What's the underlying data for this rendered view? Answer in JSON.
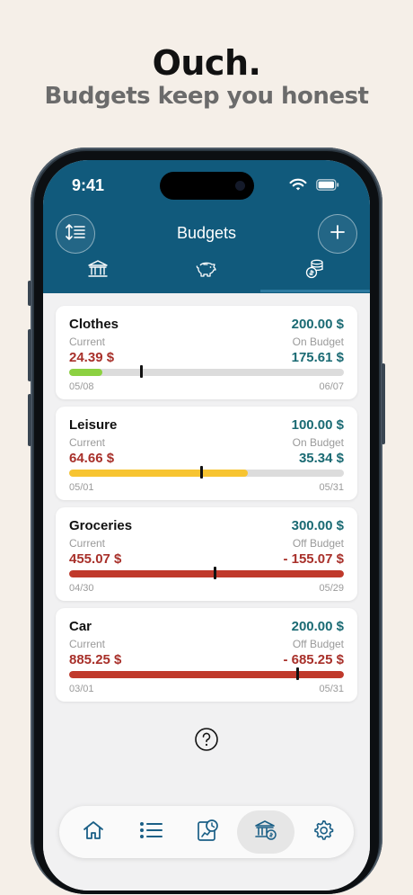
{
  "promo": {
    "title": "Ouch.",
    "subtitle": "Budgets keep you honest"
  },
  "status_bar": {
    "time": "9:41"
  },
  "header": {
    "title": "Budgets",
    "left_button_icon": "sort-icon",
    "right_button_icon": "plus-icon",
    "tabs": [
      {
        "icon": "bank-icon",
        "active": false
      },
      {
        "icon": "piggy-bank-icon",
        "active": false
      },
      {
        "icon": "coins-icon",
        "active": true
      }
    ]
  },
  "budgets": [
    {
      "name": "Clothes",
      "budget": "200.00 $",
      "current_label": "Current",
      "status_label": "On Budget",
      "current": "24.39 $",
      "remaining": "175.61 $",
      "start": "05/08",
      "end": "06/07",
      "spent_fraction": 0.12,
      "time_fraction": 0.26,
      "bar_color": "#8cd141",
      "remaining_color": "#1a6a73"
    },
    {
      "name": "Leisure",
      "budget": "100.00 $",
      "current_label": "Current",
      "status_label": "On Budget",
      "current": "64.66 $",
      "remaining": "35.34 $",
      "start": "05/01",
      "end": "05/31",
      "spent_fraction": 0.65,
      "time_fraction": 0.48,
      "bar_color": "#f7c431",
      "remaining_color": "#1a6a73"
    },
    {
      "name": "Groceries",
      "budget": "300.00 $",
      "current_label": "Current",
      "status_label": "Off Budget",
      "current": "455.07 $",
      "remaining": "- 155.07 $",
      "start": "04/30",
      "end": "05/29",
      "spent_fraction": 1.0,
      "time_fraction": 0.53,
      "bar_color": "#c0392b",
      "remaining_color": "#a8302a"
    },
    {
      "name": "Car",
      "budget": "200.00 $",
      "current_label": "Current",
      "status_label": "Off Budget",
      "current": "885.25 $",
      "remaining": "- 685.25 $",
      "start": "03/01",
      "end": "05/31",
      "spent_fraction": 1.0,
      "time_fraction": 0.83,
      "bar_color": "#c0392b",
      "remaining_color": "#a8302a"
    }
  ],
  "help_icon": "question-circle-icon",
  "tabbar": [
    {
      "icon": "home-icon",
      "active": false
    },
    {
      "icon": "list-icon",
      "active": false
    },
    {
      "icon": "reports-icon",
      "active": false
    },
    {
      "icon": "budgets-bank-icon",
      "active": true
    },
    {
      "icon": "settings-gear-icon",
      "active": false
    }
  ],
  "colors": {
    "header": "#115a7c",
    "accent_teal": "#1a6a73",
    "over_red": "#a8302a",
    "background": "#f5efe8"
  }
}
